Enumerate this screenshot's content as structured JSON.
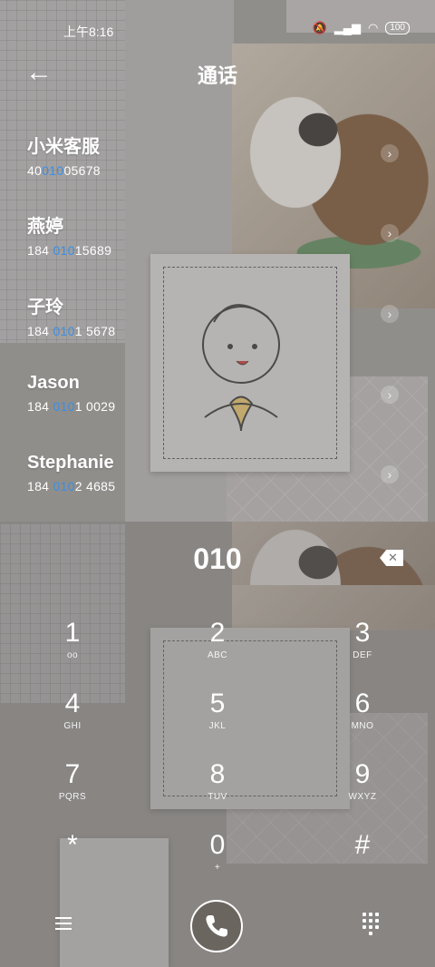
{
  "status_bar": {
    "time": "上午8:16",
    "battery": "100"
  },
  "header": {
    "title": "通话",
    "back_icon": "arrow-left-icon"
  },
  "contacts": [
    {
      "name": "小米客服",
      "num_pre": "40",
      "num_hl": "010",
      "num_post": "05678"
    },
    {
      "name": "燕婷",
      "num_pre": "184 ",
      "num_hl": "010",
      "num_post": "15689"
    },
    {
      "name": "子玲",
      "num_pre": "184 ",
      "num_hl": "010",
      "num_post": "1 5678"
    },
    {
      "name": "Jason",
      "num_pre": "184 ",
      "num_hl": "010",
      "num_post": "1 0029"
    },
    {
      "name": "Stephanie",
      "num_pre": "184 ",
      "num_hl": "010",
      "num_post": "2 4685"
    }
  ],
  "dialer": {
    "input": "010",
    "keys": [
      {
        "digit": "1",
        "letters": "voicemail-icon"
      },
      {
        "digit": "2",
        "letters": "ABC"
      },
      {
        "digit": "3",
        "letters": "DEF"
      },
      {
        "digit": "4",
        "letters": "GHI"
      },
      {
        "digit": "5",
        "letters": "JKL"
      },
      {
        "digit": "6",
        "letters": "MNO"
      },
      {
        "digit": "7",
        "letters": "PQRS"
      },
      {
        "digit": "8",
        "letters": "TUV"
      },
      {
        "digit": "9",
        "letters": "WXYZ"
      },
      {
        "digit": "*",
        "letters": ""
      },
      {
        "digit": "0",
        "letters": "+"
      },
      {
        "digit": "#",
        "letters": ""
      }
    ]
  },
  "bottom_bar": {
    "menu_icon": "hamburger-menu-icon",
    "call_icon": "phone-icon",
    "keypad_icon": "keypad-icon"
  },
  "colors": {
    "highlight": "#3a8ee6",
    "call_button": "#6b655f"
  }
}
